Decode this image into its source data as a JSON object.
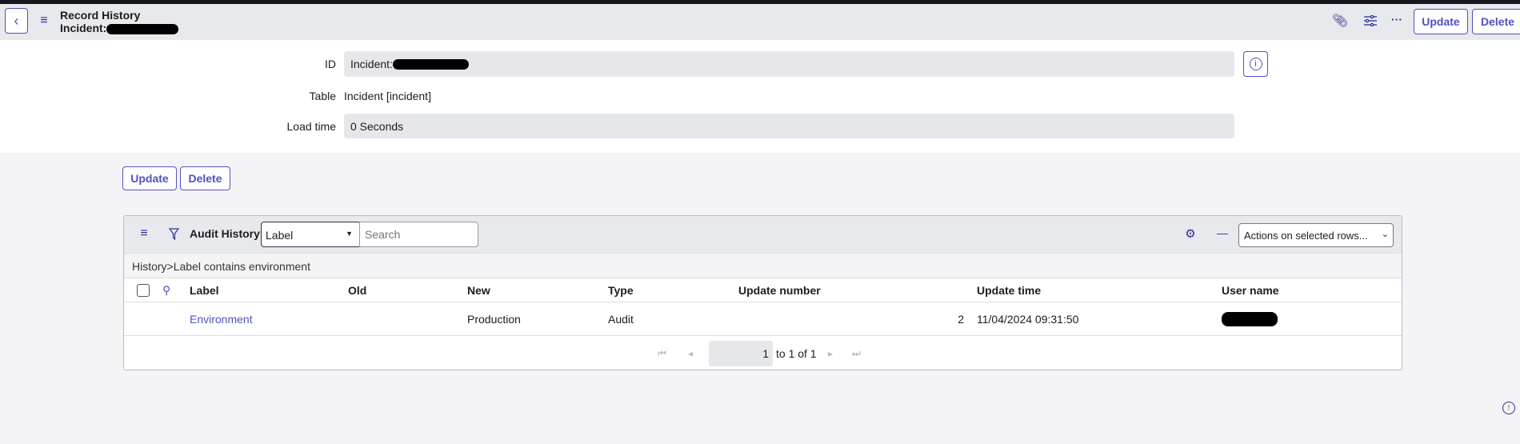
{
  "header": {
    "title": "Record History",
    "subtitle": "Incident:",
    "update_label": "Update",
    "delete_label": "Delete"
  },
  "form": {
    "id_label": "ID",
    "id_value": "Incident:",
    "table_label": "Table",
    "table_value": "Incident [incident]",
    "load_label": "Load time",
    "load_value": "0 Seconds"
  },
  "actions": {
    "update_label": "Update",
    "delete_label": "Delete"
  },
  "list": {
    "title": "Audit History",
    "search_field": "Label",
    "search_placeholder": "Search",
    "actions_select": "Actions on selected rows...",
    "breadcrumb": "History>Label contains environment",
    "columns": [
      "Label",
      "Old",
      "New",
      "Type",
      "Update number",
      "Update time",
      "User name"
    ],
    "rows": [
      {
        "label": "Environment",
        "old": "",
        "new": "Production",
        "type": "Audit",
        "update_number": "2",
        "update_time": "11/04/2024 09:31:50"
      }
    ],
    "pager": {
      "current": "1",
      "range": "to 1 of 1"
    }
  },
  "colors": {
    "accent": "#4f52bd",
    "header_bg": "#e8e9ed"
  }
}
